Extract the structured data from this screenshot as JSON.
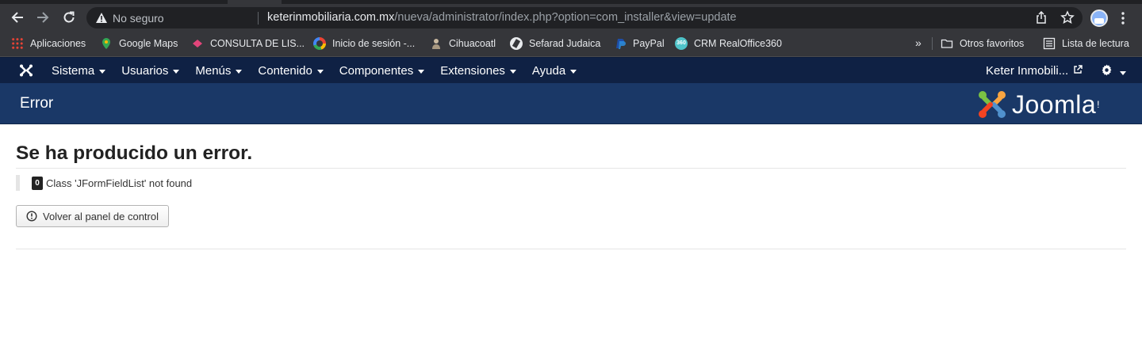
{
  "browser": {
    "insecure_label": "No seguro",
    "url_host": "keterinmobiliaria.com.mx",
    "url_path": "/nueva/administrator/index.php?option=com_installer&view=update",
    "bookmarks": [
      {
        "label": "Aplicaciones",
        "icon": "apps-grid-icon"
      },
      {
        "label": "Google Maps",
        "icon": "google-maps-icon"
      },
      {
        "label": "CONSULTA DE LIS...",
        "icon": "diamond-icon"
      },
      {
        "label": "Inicio de sesión -...",
        "icon": "google-icon"
      },
      {
        "label": "Cihuacoatl",
        "icon": "person-icon"
      },
      {
        "label": "Sefarad Judaica",
        "icon": "globe-icon"
      },
      {
        "label": "PayPal",
        "icon": "paypal-icon"
      },
      {
        "label": "CRM RealOffice360",
        "icon": "crm-icon"
      }
    ],
    "more_label": "»",
    "other_favorites": "Otros favoritos",
    "reading_list": "Lista de lectura"
  },
  "admin_nav": {
    "menu": [
      "Sistema",
      "Usuarios",
      "Menús",
      "Contenido",
      "Componentes",
      "Extensiones",
      "Ayuda"
    ],
    "site_link": "Keter Inmobili..."
  },
  "header": {
    "title": "Error",
    "brand": "Joomla",
    "brand_mark": "!"
  },
  "error": {
    "heading": "Se ha producido un error.",
    "code": "0",
    "message": "Class 'JFormFieldList' not found",
    "back_button": "Volver al panel de control"
  },
  "colors": {
    "navbar": "#0f2144",
    "header": "#1a3867",
    "chrome_toolbar": "#35363a"
  }
}
